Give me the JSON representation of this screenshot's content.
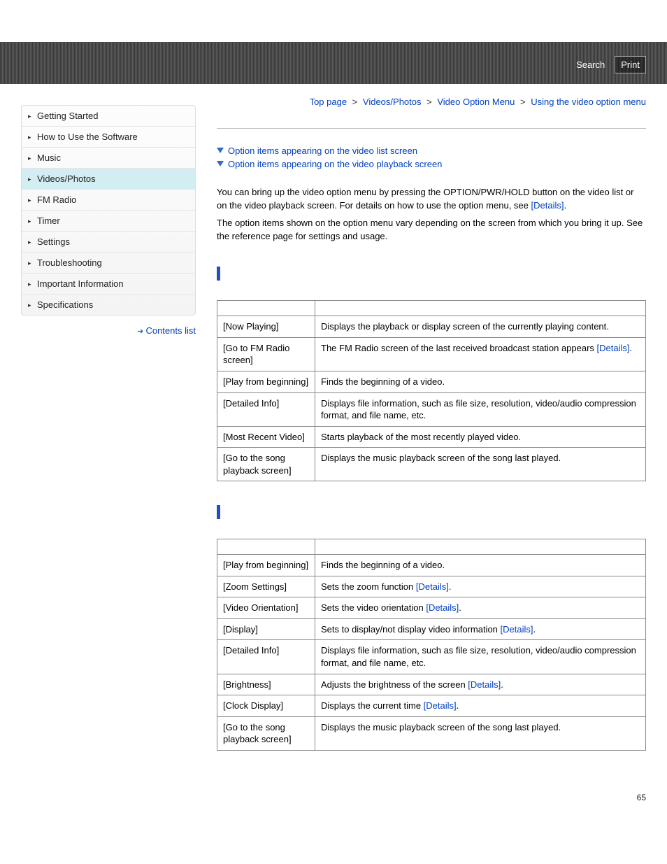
{
  "header": {
    "search": "Search",
    "print": "Print"
  },
  "breadcrumb": {
    "items": [
      "Top page",
      "Videos/Photos",
      "Video Option Menu"
    ],
    "current": "Using the video option menu",
    "sep": ">"
  },
  "sidebar": {
    "items": [
      "Getting Started",
      "How to Use the Software",
      "Music",
      "Videos/Photos",
      "FM Radio",
      "Timer",
      "Settings",
      "Troubleshooting",
      "Important Information",
      "Specifications"
    ],
    "active_index": 3,
    "contents_link": "Contents list"
  },
  "anchors": {
    "a1": "Option items appearing on the video list screen",
    "a2": "Option items appearing on the video playback screen"
  },
  "intro": {
    "p1a": "You can bring up the video option menu by pressing the OPTION/PWR/HOLD button on the video list or on the video playback screen. For details on how to use the option menu, see ",
    "details": "[Details]",
    "p1b": ".",
    "p2": "The option items shown on the option menu vary depending on the screen from which you bring it up. See the reference page for settings and usage."
  },
  "table1": {
    "head": [
      "",
      ""
    ],
    "rows": [
      {
        "c0": "[Now Playing]",
        "c1": "Displays the playback or display screen of the currently playing content."
      },
      {
        "c0": "[Go to FM Radio screen]",
        "c1_pre": "The FM Radio screen of the last received broadcast station appears ",
        "c1_link": "[Details]",
        "c1_post": "."
      },
      {
        "c0": "[Play from beginning]",
        "c1": "Finds the beginning of a video."
      },
      {
        "c0": "[Detailed Info]",
        "c1": "Displays file information, such as file size, resolution, video/audio compression format, and file name, etc."
      },
      {
        "c0": "[Most Recent Video]",
        "c1": "Starts playback of the most recently played video."
      },
      {
        "c0": "[Go to the song playback screen]",
        "c1": "Displays the music playback screen of the song last played."
      }
    ]
  },
  "table2": {
    "head": [
      "",
      ""
    ],
    "rows": [
      {
        "c0": "[Play from beginning]",
        "c1": "Finds the beginning of a video."
      },
      {
        "c0": "[Zoom Settings]",
        "c1_pre": "Sets the zoom function ",
        "c1_link": "[Details]",
        "c1_post": "."
      },
      {
        "c0": "[Video Orientation]",
        "c1_pre": "Sets the video orientation ",
        "c1_link": "[Details]",
        "c1_post": "."
      },
      {
        "c0": "[Display]",
        "c1_pre": "Sets to display/not display video information ",
        "c1_link": "[Details]",
        "c1_post": "."
      },
      {
        "c0": "[Detailed Info]",
        "c1": "Displays file information, such as file size, resolution, video/audio compression format, and file name, etc."
      },
      {
        "c0": "[Brightness]",
        "c1_pre": "Adjusts the brightness of the screen ",
        "c1_link": "[Details]",
        "c1_post": "."
      },
      {
        "c0": "[Clock Display]",
        "c1_pre": "Displays the current time ",
        "c1_link": "[Details]",
        "c1_post": "."
      },
      {
        "c0": "[Go to the song playback screen]",
        "c1": "Displays the music playback screen of the song last played."
      }
    ]
  },
  "page_number": "65"
}
